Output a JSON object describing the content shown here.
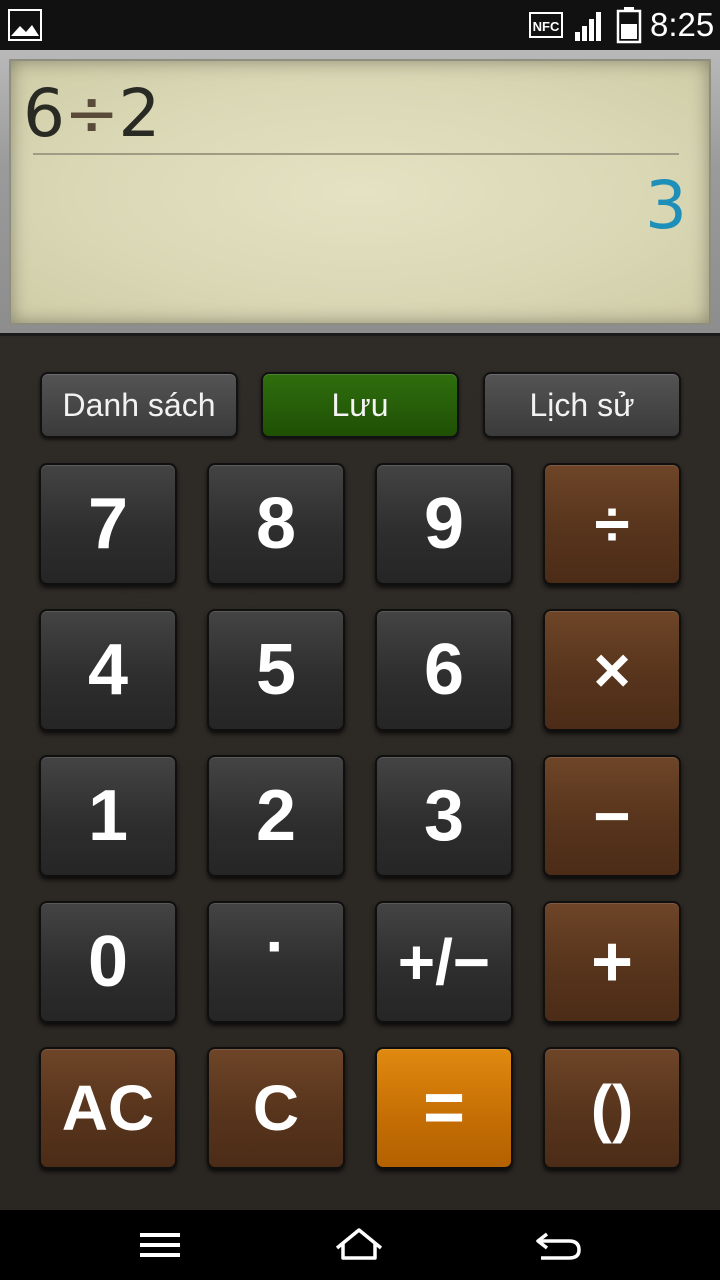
{
  "status_bar": {
    "time": "8:25",
    "left_icon": "gallery-icon",
    "icons": [
      "nfc-icon",
      "signal-icon",
      "battery-icon"
    ]
  },
  "display": {
    "expression": {
      "operand1": "6",
      "operator": "÷",
      "operand2": "2"
    },
    "result": "3"
  },
  "top_buttons": {
    "list": "Danh sách",
    "save": "Lưu",
    "history": "Lịch sử"
  },
  "keys": {
    "seven": "7",
    "eight": "8",
    "nine": "9",
    "divide": "÷",
    "four": "4",
    "five": "5",
    "six": "6",
    "multiply": "×",
    "one": "1",
    "two": "2",
    "three": "3",
    "minus": "−",
    "zero": "0",
    "dot": "·",
    "sign": "+/−",
    "plus": "+",
    "all_clear": "AC",
    "clear": "C",
    "equals": "=",
    "parens": "()"
  },
  "nav_bar": {
    "icons": [
      "menu-icon",
      "home-icon",
      "back-icon"
    ]
  },
  "colors": {
    "result_text": "#1e8fb8",
    "save_button": "#2f6e0e",
    "operator_keys": "#57341c",
    "equals_key": "#c46d04"
  }
}
